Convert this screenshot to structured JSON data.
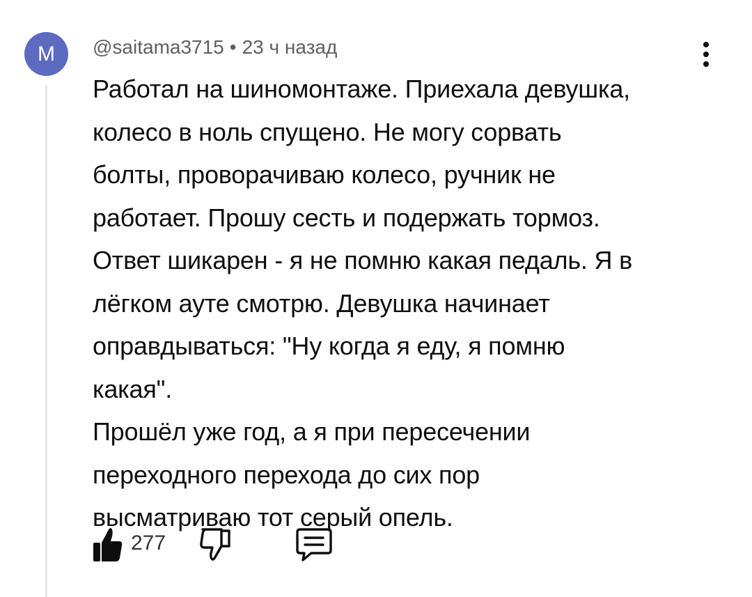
{
  "comment": {
    "avatar_letter": "M",
    "avatar_color": "#5c6bc0",
    "username": "@saitama3715",
    "separator": "•",
    "time": "23 ч назад",
    "text_lines": [
      "Работал на шиномонтаже. Приехала девушка,",
      "колесо в ноль спущено. Не могу сорвать",
      "болты, проворачиваю колесо, ручник не",
      "работает. Прошу сесть и подержать тормоз.",
      "Ответ шикарен - я не помню какая педаль. Я в",
      "лёгком ауте смотрю. Девушка начинает",
      "оправдываться: \"Ну когда я еду, я помню",
      "какая\".",
      "Прошёл уже год, а я при пересечении",
      "переходного перехода до сих пор",
      "высматриваю тот серый опель."
    ],
    "likes": "277",
    "icons": {
      "like": "thumbs-up-filled-icon",
      "dislike": "thumbs-down-outline-icon",
      "reply": "reply-comment-icon",
      "menu": "more-vertical-icon"
    }
  }
}
